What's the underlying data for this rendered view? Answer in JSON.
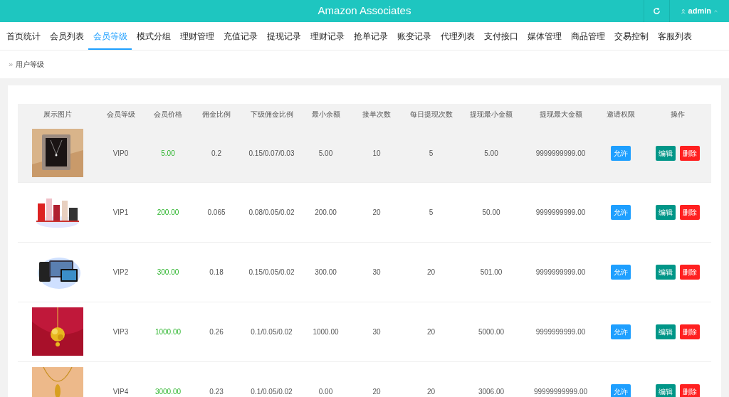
{
  "header": {
    "title": "Amazon Associates",
    "user": "admin"
  },
  "nav": [
    {
      "label": "首页统计",
      "selected": false
    },
    {
      "label": "会员列表",
      "selected": false
    },
    {
      "label": "会员等级",
      "selected": true
    },
    {
      "label": "模式分组",
      "selected": false
    },
    {
      "label": "理财管理",
      "selected": false
    },
    {
      "label": "充值记录",
      "selected": false
    },
    {
      "label": "提现记录",
      "selected": false
    },
    {
      "label": "理财记录",
      "selected": false
    },
    {
      "label": "抢单记录",
      "selected": false
    },
    {
      "label": "账变记录",
      "selected": false
    },
    {
      "label": "代理列表",
      "selected": false
    },
    {
      "label": "支付接口",
      "selected": false
    },
    {
      "label": "媒体管理",
      "selected": false
    },
    {
      "label": "商品管理",
      "selected": false
    },
    {
      "label": "交易控制",
      "selected": false
    },
    {
      "label": "客服列表",
      "selected": false
    }
  ],
  "breadcrumb": {
    "icon": "»",
    "label": "用户等级"
  },
  "table": {
    "columns": [
      "展示图片",
      "会员等级",
      "会员价格",
      "佣金比例",
      "下级佣金比例",
      "最小余额",
      "接单次数",
      "每日提现次数",
      "提现最小金额",
      "提现最大金额",
      "邀请权限",
      "操作"
    ],
    "rows": [
      {
        "level": "VIP0",
        "price": "5.00",
        "commission": "0.2",
        "sub_commission": "0.15/0.07/0.03",
        "min_balance": "5.00",
        "orders": "10",
        "daily_withdrawals": "5",
        "min_withdrawal": "5.00",
        "max_withdrawal": "9999999999.00",
        "invite": "允许",
        "actions": [
          "编辑",
          "删除"
        ],
        "highlighted": true
      },
      {
        "level": "VIP1",
        "price": "200.00",
        "commission": "0.065",
        "sub_commission": "0.08/0.05/0.02",
        "min_balance": "200.00",
        "orders": "20",
        "daily_withdrawals": "5",
        "min_withdrawal": "50.00",
        "max_withdrawal": "9999999999.00",
        "invite": "允许",
        "actions": [
          "编辑",
          "删除"
        ],
        "highlighted": false
      },
      {
        "level": "VIP2",
        "price": "300.00",
        "commission": "0.18",
        "sub_commission": "0.15/0.05/0.02",
        "min_balance": "300.00",
        "orders": "30",
        "daily_withdrawals": "20",
        "min_withdrawal": "501.00",
        "max_withdrawal": "9999999999.00",
        "invite": "允许",
        "actions": [
          "编辑",
          "删除"
        ],
        "highlighted": false
      },
      {
        "level": "VIP3",
        "price": "1000.00",
        "commission": "0.26",
        "sub_commission": "0.1/0.05/0.02",
        "min_balance": "1000.00",
        "orders": "30",
        "daily_withdrawals": "20",
        "min_withdrawal": "5000.00",
        "max_withdrawal": "9999999999.00",
        "invite": "允许",
        "actions": [
          "编辑",
          "删除"
        ],
        "highlighted": false
      },
      {
        "level": "VIP4",
        "price": "3000.00",
        "commission": "0.23",
        "sub_commission": "0.1/0.05/0.02",
        "min_balance": "0.00",
        "orders": "20",
        "daily_withdrawals": "20",
        "min_withdrawal": "3006.00",
        "max_withdrawal": "99999999999.00",
        "invite": "允许",
        "actions": [
          "编辑",
          "删除"
        ],
        "highlighted": false
      }
    ]
  }
}
